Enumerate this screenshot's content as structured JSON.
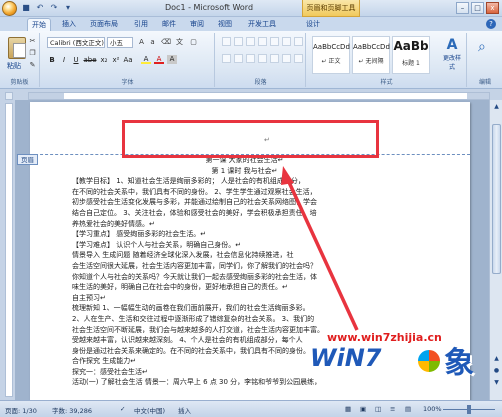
{
  "window": {
    "title": "Doc1 - Microsoft Word",
    "context_tools": "页眉和页脚工具",
    "controls": {
      "minimize": "–",
      "maximize": "□",
      "close": "x"
    }
  },
  "tabs": [
    "开始",
    "插入",
    "页面布局",
    "引用",
    "邮件",
    "审阅",
    "视图",
    "开发工具",
    "设计"
  ],
  "ribbon": {
    "clipboard": {
      "paste": "粘贴",
      "label": "剪贴板"
    },
    "font": {
      "name": "Calibri (西文正文)",
      "size": "小五",
      "label": "字体",
      "format": [
        "B",
        "I",
        "U",
        "abe",
        "x₂",
        "x²",
        "Aa"
      ],
      "color": [
        "A",
        "A",
        "A"
      ]
    },
    "paragraph": {
      "label": "段落"
    },
    "styles": {
      "items": [
        {
          "sample": "AaBbCcDd",
          "name": "↵ 正文"
        },
        {
          "sample": "AaBbCcDd",
          "name": "↵ 无间隔"
        },
        {
          "sample": "AaBb",
          "name": "标题 1"
        }
      ],
      "change_styles": "更改样式",
      "label": "样式"
    },
    "editing": {
      "label": "编辑"
    }
  },
  "document": {
    "header_tag": "页眉",
    "header_para_mark": "↵",
    "lines": [
      "第一课  大家的社会生活↵",
      "第 1 课时  我与社会↵",
      "【教学目标】    1、知道社会生活是绚丽多彩的；    人是社会的有机组成部分，",
      "在不同的社会关系中，我们具有不同的身份。    2、学生学生通过观察社会生活，",
      "初步感受社会生活变化发展与多彩，并能通过绘制自己的社会关系网络图，学会",
      "结合自己定位。    3、关注社会，体验和感受社会的美好，学会积极承担责任，培",
      "养热爱社会的美好情感。↵",
      "【学习重点】    感受绚丽多彩的社会生活。↵",
      "【学习难点】    认识个人与社会关系，明确自己身份。↵",
      "    情景导入  生成问题    随着经济全球化深入发展，社会信息化持续推进，社",
      "会生活空间很大延展，社会生活内容更加丰富，同学们，你了解我们的社会吗？",
      "你知道个人与社会的关系吗？今天就让我们一起去感受绚丽多彩的社会生活，体",
      "味生活的美好，明确自己在社会中的身份，更好地承担自己的责任。↵",
      "    自主预习↵",
      "    梳理新知    1、一幅幅生动的画卷在我们面前展开，我们的社会生活绚丽多彩。",
      "    2、人在生产、生活和交往过程中逐渐形成了错综复杂的社会关系。    3、我们的",
      "社会生活空间不断延展，我们会与越来越多的人打交道，社会生活内容更加丰富。",
      "受越来越丰富，认识越来越深刻。    4、个人是社会的有机组成部分，每个人",
      "身份是通过社会关系来确定的。在不同的社会关系中，我们具有不同的身份。",
      "合作探究  生成能力↵",
      "探究一：感受社会生活↵",
      "活动(一) 了解社会生活    情景一：周六早上 6 点 30 分，李铭和爷爷到公园晨练，"
    ]
  },
  "watermark": {
    "url": "www.win7zhijia.cn",
    "brand": "WiN7",
    "char": "象"
  },
  "statusbar": {
    "page": "页面: 1/30",
    "words": "字数: 39,286",
    "lang": "中文(中国)",
    "mode": "插入",
    "zoom": "100%"
  },
  "colors": {
    "highlight": "#e8343f",
    "accent": "#2b6ab8"
  }
}
